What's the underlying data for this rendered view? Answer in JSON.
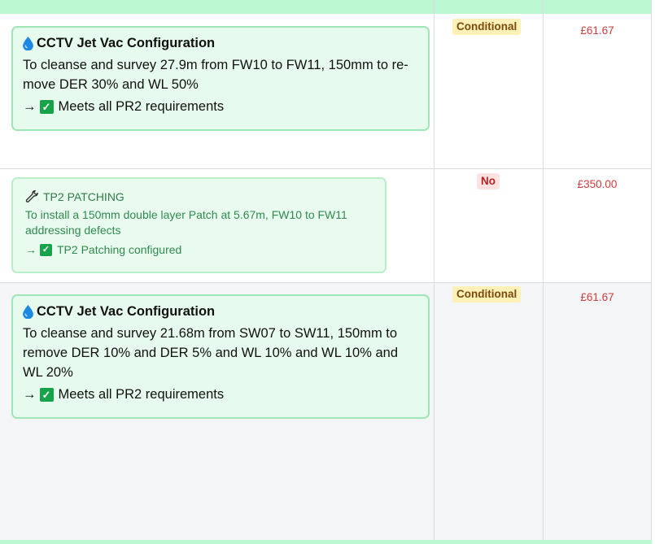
{
  "rows": [
    {
      "title": "CCTV Jet Vac Configuration",
      "description": "To cleanse and survey 27.9m from FW10 to FW11, 150mm to re-move DER 30% and WL 50%",
      "description_line1": "To cleanse and survey 27.9m from FW10 to FW11, 150mm to re-",
      "description_line2": "move DER 30% and WL 50%",
      "status_text": "Meets all PR2 requirements",
      "badge": "Conditional",
      "price": "£61.67"
    },
    {
      "title": "TP2 PATCHING",
      "description_line1": "To install a 150mm double layer Patch at 5.67m, FW10 to FW11",
      "description_line2": "addressing defects",
      "status_text": "TP2 Patching configured",
      "badge": "No",
      "price": "£350.00"
    },
    {
      "title": "CCTV Jet Vac Configuration",
      "description_line1": "To cleanse and survey 21.68m from SW07 to SW11, 150mm to",
      "description_line2": "remove DER 10% and DER 5% and WL 10% and WL 10% and",
      "description_line3": "WL 20%",
      "status_text": "Meets all PR2 requirements",
      "badge": "Conditional",
      "price": "£61.67"
    }
  ],
  "arrow": "→",
  "check_glyph": "✓",
  "colors": {
    "header_green": "#bbf7d0",
    "card_bg": "#e6fbed",
    "card_border": "#9ee6b6",
    "conditional_bg": "#fdf1b8",
    "no_bg": "#fde2e2",
    "price_red": "#d23b3b"
  },
  "icons": {
    "cctv": "water-drop-icon",
    "patch": "wrench-icon",
    "status": "check-box-icon"
  }
}
